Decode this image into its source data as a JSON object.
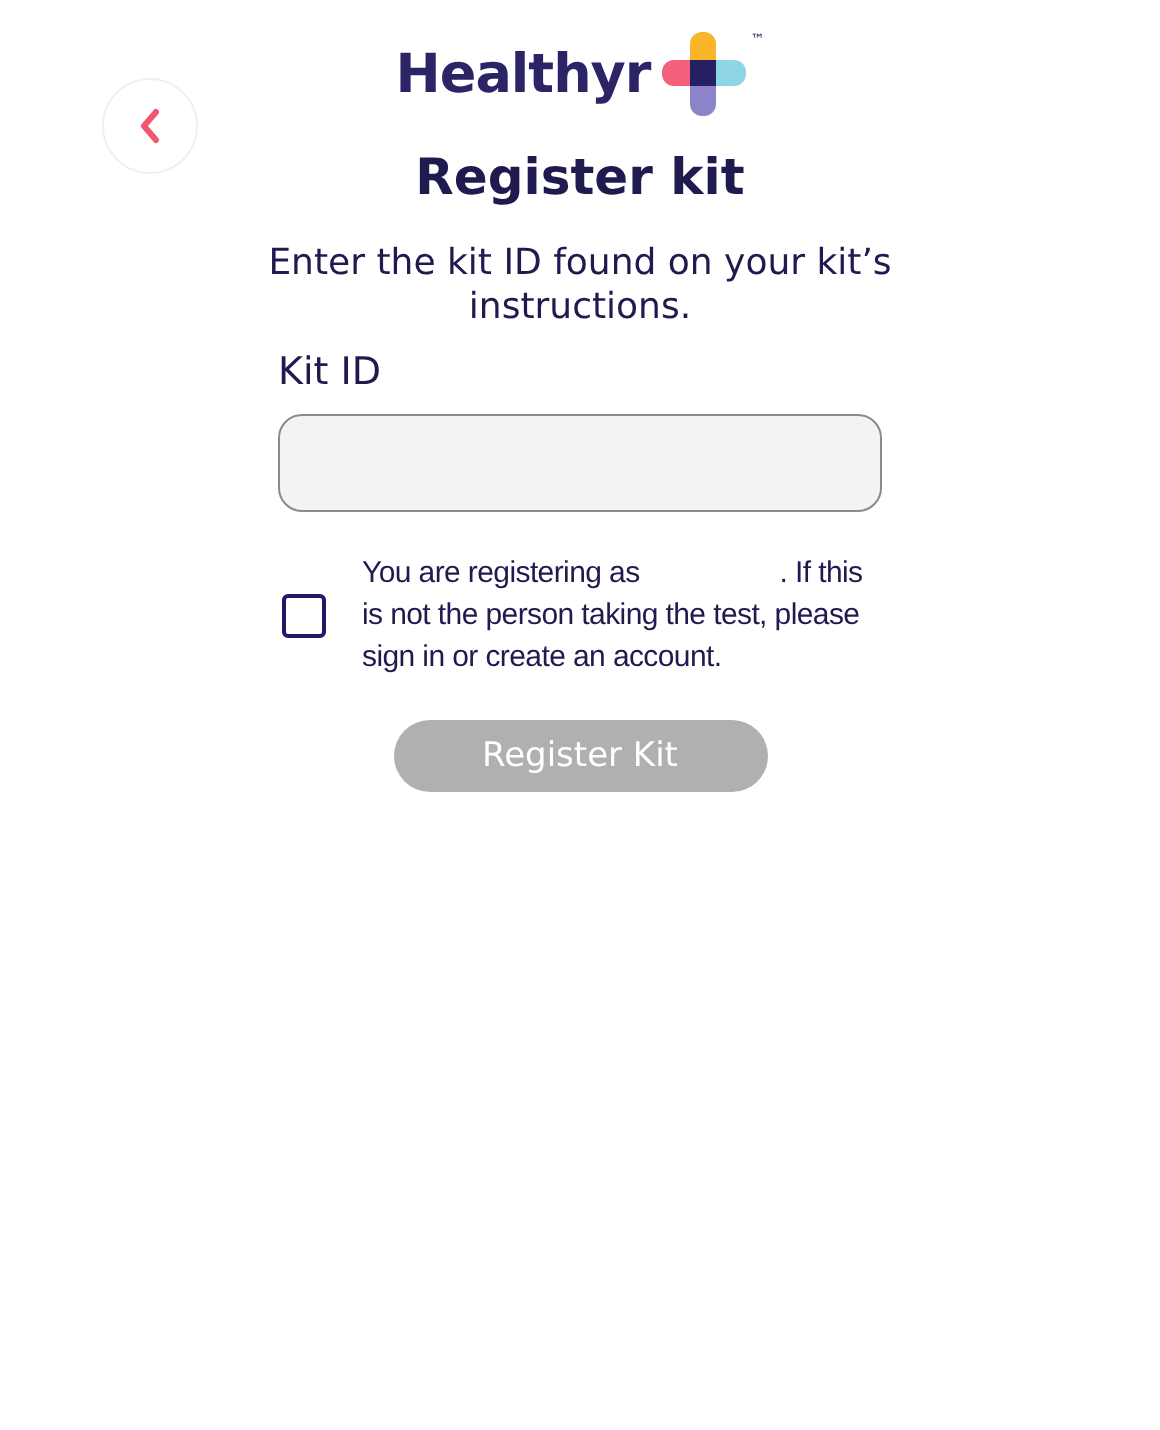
{
  "logo": {
    "wordmark": "Healthyr",
    "trademark": "™"
  },
  "title": "Register kit",
  "instructions": "Enter the kit ID found on your kit’s instructions.",
  "kit_id_field": {
    "label": "Kit ID"
  },
  "consent": {
    "checked": false,
    "text_before": "You are registering as",
    "text_after": ". If this is not the person taking the test, please sign in or create an account."
  },
  "submit_button": {
    "label": "Register Kit",
    "disabled": true
  }
}
